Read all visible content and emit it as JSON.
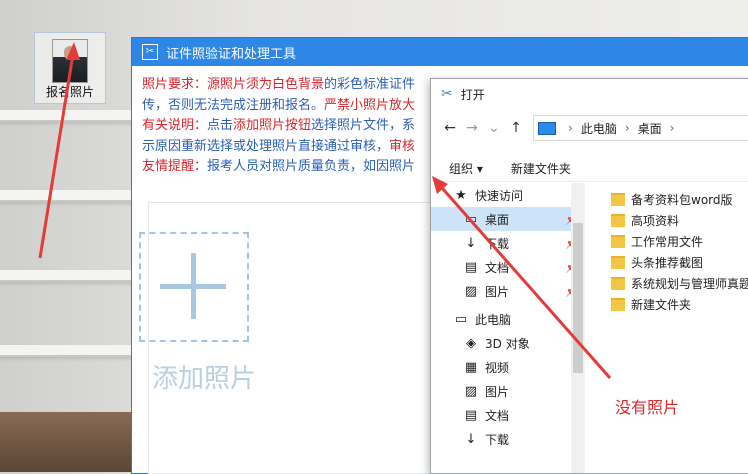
{
  "desktop": {
    "icon_label": "报名照片"
  },
  "tool_window": {
    "title": "证件照验证和处理工具",
    "notes": [
      [
        {
          "c": "r",
          "t": "照片要求：源照片须为"
        },
        {
          "c": "r",
          "t": "白色背景"
        },
        {
          "c": "b",
          "t": "的彩色标准证件"
        }
      ],
      [
        {
          "c": "b",
          "t": "传，否则无法完成注册和报名。"
        },
        {
          "c": "r",
          "t": "严禁小照片放大"
        }
      ],
      [
        {
          "c": "r",
          "t": "有关说明："
        },
        {
          "c": "b",
          "t": "点击"
        },
        {
          "c": "r",
          "t": "添加照片按钮"
        },
        {
          "c": "b",
          "t": "选择照片文件，系"
        }
      ],
      [
        {
          "c": "b",
          "t": "示原因重新选择或处理照片直接通过审核，"
        },
        {
          "c": "r",
          "t": "审核"
        }
      ],
      [
        {
          "c": "r",
          "t": "友情提醒："
        },
        {
          "c": "b",
          "t": "报考人员对照片质量负责，如因照片"
        }
      ]
    ],
    "add_photo_label": "添加照片"
  },
  "open_dialog": {
    "title": "打开",
    "address": {
      "root": "此电脑",
      "current": "桌面"
    },
    "toolbar": {
      "organize": "组织 ▾",
      "new_folder": "新建文件夹"
    },
    "nav_items": [
      {
        "label": "快速访问",
        "icon": "star-icon",
        "glyph": "★",
        "pin": false,
        "sel": false
      },
      {
        "label": "桌面",
        "icon": "desktop-icon",
        "glyph": "▭",
        "pin": true,
        "sel": true
      },
      {
        "label": "下载",
        "icon": "download-icon",
        "glyph": "↓",
        "pin": true,
        "sel": false
      },
      {
        "label": "文档",
        "icon": "document-icon",
        "glyph": "▤",
        "pin": true,
        "sel": false
      },
      {
        "label": "图片",
        "icon": "picture-icon",
        "glyph": "▨",
        "pin": true,
        "sel": false
      },
      {
        "label": "此电脑",
        "icon": "computer-icon",
        "glyph": "▭",
        "pin": false,
        "sel": false
      },
      {
        "label": "3D 对象",
        "icon": "cube-icon",
        "glyph": "◈",
        "pin": false,
        "sel": false
      },
      {
        "label": "视频",
        "icon": "video-icon",
        "glyph": "▦",
        "pin": false,
        "sel": false
      },
      {
        "label": "图片",
        "icon": "picture-icon",
        "glyph": "▨",
        "pin": false,
        "sel": false
      },
      {
        "label": "文档",
        "icon": "document-icon",
        "glyph": "▤",
        "pin": false,
        "sel": false
      },
      {
        "label": "下载",
        "icon": "download-icon",
        "glyph": "↓",
        "pin": false,
        "sel": false
      }
    ],
    "files": [
      "备考资料包word版",
      "高项资料",
      "工作常用文件",
      "头条推荐截图",
      "系统规划与管理师真题",
      "新建文件夹"
    ]
  },
  "annotation": {
    "text": "没有照片",
    "color": "#e02a2a"
  }
}
